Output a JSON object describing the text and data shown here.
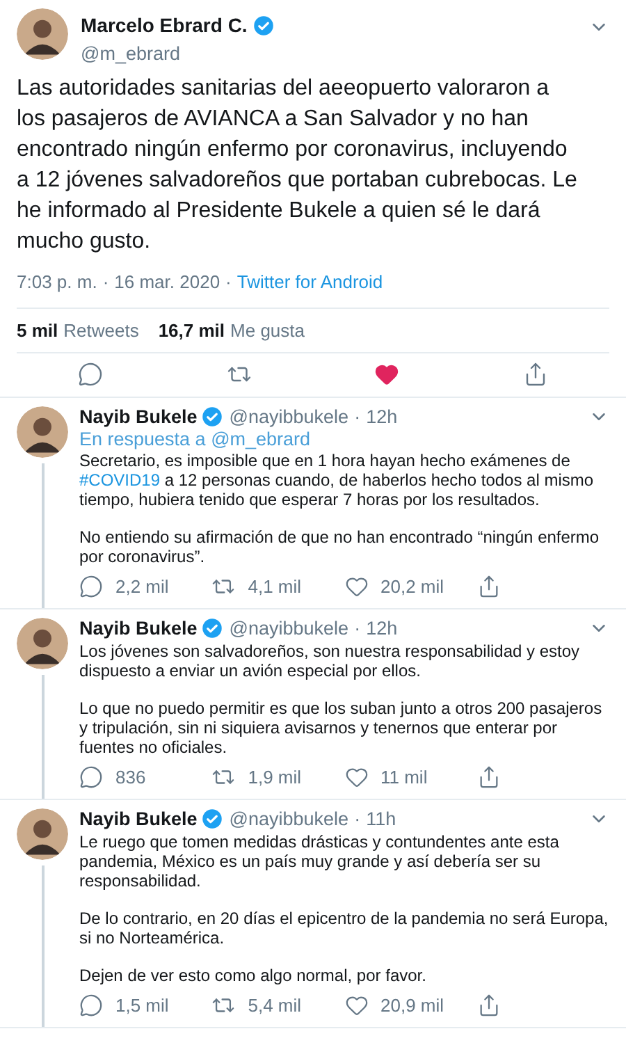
{
  "main_tweet": {
    "author": "Marcelo Ebrard C.",
    "verified": true,
    "handle": "@m_ebrard",
    "text": "Las autoridades sanitarias del aeeopuerto valoraron a los pasajeros de AVIANCA a San Salvador y no han encontrado ningún enfermo por coronavirus, incluyendo a 12 jóvenes salvadoreños que portaban cubrebocas. Le he informado al Presidente Bukele a quien sé le dará mucho gusto.",
    "time": "7:03 p. m.",
    "separator_1": "·",
    "date": "16 mar. 2020",
    "separator_2": "·",
    "source": "Twitter for Android",
    "retweets_count": "5 mil",
    "retweets_label": "Retweets",
    "likes_count": "16,7 mil",
    "likes_label": "Me gusta",
    "liked": true
  },
  "replies": [
    {
      "author": "Nayib Bukele",
      "verified": true,
      "handle": "@nayibbukele",
      "separator": "·",
      "age": "12h",
      "reply_to": {
        "prefix": "En respuesta a",
        "mention": "@m_ebrard"
      },
      "paragraphs": [
        [
          {
            "kind": "text",
            "text": "Secretario, es imposible que en 1 hora hayan hecho exámenes de "
          },
          {
            "kind": "hashtag",
            "text": "#COVID19"
          },
          {
            "kind": "text",
            "text": " a 12 personas cuando, de haberlos hecho todos al mismo tiempo, hubiera tenido que esperar 7 horas por los resultados."
          }
        ],
        [
          {
            "kind": "text",
            "text": "No entiendo su afirmación de que no han encontrado “ningún enfermo por coronavirus”."
          }
        ]
      ],
      "reply_count": "2,2 mil",
      "retweet_count": "4,1 mil",
      "like_count": "20,2 mil",
      "liked": false
    },
    {
      "author": "Nayib Bukele",
      "verified": true,
      "handle": "@nayibbukele",
      "separator": "·",
      "age": "12h",
      "paragraphs": [
        [
          {
            "kind": "text",
            "text": "Los jóvenes son salvadoreños, son nuestra responsabilidad y estoy dispuesto a enviar un avión especial por ellos."
          }
        ],
        [
          {
            "kind": "text",
            "text": "Lo que no puedo permitir es que los suban junto a otros 200 pasajeros y tripulación, sin ni siquiera avisarnos y tenernos que enterar por fuentes no oficiales."
          }
        ]
      ],
      "reply_count": "836",
      "retweet_count": "1,9 mil",
      "like_count": "11 mil",
      "liked": false
    },
    {
      "author": "Nayib Bukele",
      "verified": true,
      "handle": "@nayibbukele",
      "separator": "·",
      "age": "11h",
      "paragraphs": [
        [
          {
            "kind": "text",
            "text": "Le ruego que tomen medidas drásticas y contundentes ante esta pandemia, México es un país muy grande y así debería ser su responsabilidad."
          }
        ],
        [
          {
            "kind": "text",
            "text": "De lo contrario, en 20 días el epicentro de la pandemia no será Europa, si no Norteamérica."
          }
        ],
        [
          {
            "kind": "text",
            "text": "Dejen de ver esto como algo normal, por favor."
          }
        ]
      ],
      "reply_count": "1,5 mil",
      "retweet_count": "5,4 mil",
      "like_count": "20,9 mil",
      "liked": false
    }
  ]
}
